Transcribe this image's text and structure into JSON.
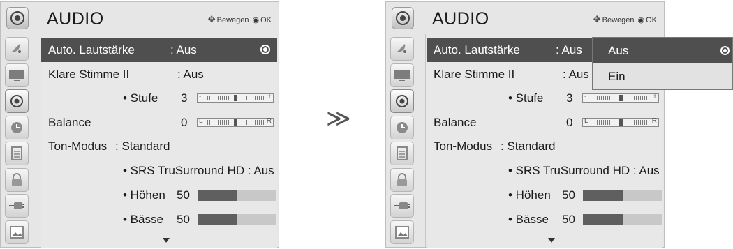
{
  "left_menu": {
    "title": "AUDIO",
    "nav_move": "Bewegen",
    "nav_ok": "OK",
    "rows": {
      "auto_volume": {
        "label": "Auto. Lautstärke",
        "value": ": Aus"
      },
      "clear_voice": {
        "label": "Klare Stimme II",
        "value": ": Aus"
      },
      "level": {
        "label": "• Stufe",
        "value": "3",
        "slider_left": "-",
        "slider_right": "+",
        "position": 0.5
      },
      "balance": {
        "label": "Balance",
        "value": "0",
        "slider_left": "L",
        "slider_right": "R",
        "position": 0.5
      },
      "sound_mode": {
        "label": "Ton-Modus",
        "value": ": Standard"
      },
      "srs": {
        "label": "• SRS TruSurround HD : Aus"
      },
      "treble": {
        "label": "• Höhen",
        "value": "50",
        "fill": 0.5
      },
      "bass": {
        "label": "• Bässe",
        "value": "50",
        "fill": 0.5
      }
    }
  },
  "right_menu": {
    "title": "AUDIO",
    "nav_move": "Bewegen",
    "nav_ok": "OK",
    "rows": {
      "auto_volume": {
        "label": "Auto. Lautstärke",
        "value": ": Aus"
      },
      "clear_voice": {
        "label": "Klare Stimme II",
        "value": ": Aus"
      },
      "level": {
        "label": "• Stufe",
        "value": "3",
        "slider_left": "-",
        "slider_right": "+",
        "position": 0.5
      },
      "balance": {
        "label": "Balance",
        "value": "0",
        "slider_left": "L",
        "slider_right": "R",
        "position": 0.5
      },
      "sound_mode": {
        "label": "Ton-Modus",
        "value": ": Standard"
      },
      "srs": {
        "label": "• SRS TruSurround HD : Aus"
      },
      "treble": {
        "label": "• Höhen",
        "value": "50",
        "fill": 0.5
      },
      "bass": {
        "label": "• Bässe",
        "value": "50",
        "fill": 0.5
      }
    },
    "popup": {
      "options": [
        "Aus",
        "Ein"
      ],
      "selected": 0
    }
  },
  "transition_arrow": "≫",
  "sidebar_icons": [
    "satellite-icon",
    "tv-screen-icon",
    "speaker-icon",
    "clock-icon",
    "channel-list-icon",
    "lock-icon",
    "input-plug-icon",
    "photo-icon"
  ],
  "colors": {
    "panel": "#e6e6e6",
    "highlight": "#4f4f4f",
    "bar_fill": "#5f5f5f",
    "bar_bg": "#c8c8c8"
  }
}
